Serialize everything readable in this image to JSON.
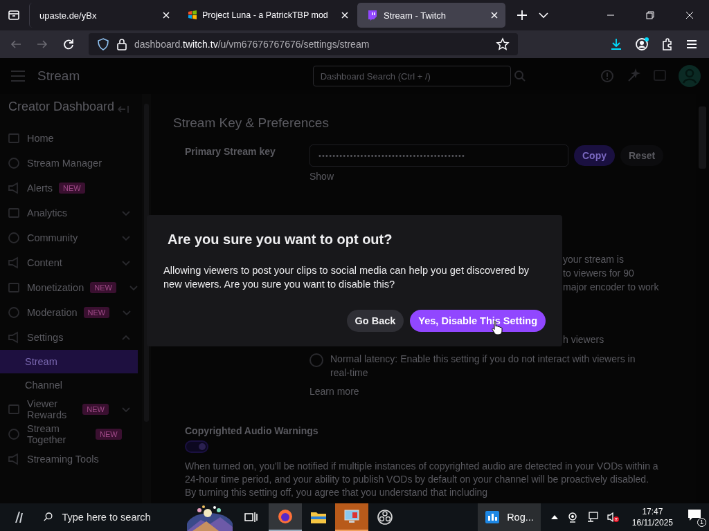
{
  "browser": {
    "tabs": [
      {
        "title": "upaste.de/yBx",
        "selected": false
      },
      {
        "title": "Project Luna - a PatrickTBP mod",
        "selected": false
      },
      {
        "title": "Stream - Twitch",
        "selected": true
      }
    ],
    "url": {
      "prefix": "dashboard.",
      "host": "twitch.tv",
      "path": "/u/vm67676767676/settings/stream"
    }
  },
  "topbar": {
    "title": "Stream",
    "search_placeholder": "Dashboard Search (Ctrl + /)"
  },
  "sidebar": {
    "title": "Creator Dashboard",
    "items": [
      {
        "label": "Home",
        "kind": "link"
      },
      {
        "label": "Stream Manager",
        "kind": "link"
      },
      {
        "label": "Alerts",
        "kind": "link",
        "badge": "NEW"
      },
      {
        "label": "Analytics",
        "kind": "group",
        "expanded": false
      },
      {
        "label": "Community",
        "kind": "group",
        "expanded": false
      },
      {
        "label": "Content",
        "kind": "group",
        "expanded": false
      },
      {
        "label": "Monetization",
        "kind": "group",
        "expanded": false,
        "badge": "NEW"
      },
      {
        "label": "Moderation",
        "kind": "group",
        "expanded": false,
        "badge": "NEW"
      },
      {
        "label": "Settings",
        "kind": "group",
        "expanded": true,
        "children": [
          {
            "label": "Stream",
            "selected": true
          },
          {
            "label": "Channel",
            "selected": false
          }
        ]
      },
      {
        "label": "Viewer Rewards",
        "kind": "group",
        "expanded": false,
        "badge": "NEW"
      },
      {
        "label": "Stream Together",
        "kind": "link",
        "badge": "NEW"
      },
      {
        "label": "Streaming Tools",
        "kind": "link"
      }
    ]
  },
  "main": {
    "title": "Stream Key & Preferences",
    "key_label": "Primary Stream key",
    "key_value": "••••••••••••••••••••••••••••••••••••••••••",
    "copy": "Copy",
    "reset": "Reset",
    "show": "Show",
    "latency_fragments": [
      "your stream is",
      "to viewers for 90",
      "major encoder to work"
    ],
    "latency_fragment_2": "h viewers",
    "normal_latency": {
      "label": "Normal latency: Enable this setting if you do not interact with viewers in real-time",
      "selected": false
    },
    "learn_more": "Learn more",
    "audio_title": "Copyrighted Audio Warnings",
    "audio_toggle": {
      "on": true
    },
    "audio_text": "When turned on, you'll be notified if multiple instances of copyrighted audio are detected in your VODs within a 24-hour time period, and your ability to publish VODs by default on your channel will be proactively disabled. By turning this setting off, you agree that you understand that including"
  },
  "dialog": {
    "title": "Are you sure you want to opt out?",
    "text": "Allowing viewers to post your clips to social media can help you get discovered by new viewers. Are you sure you want to disable this?",
    "cancel": "Go Back",
    "confirm": "Yes, Disable This Setting"
  },
  "taskbar": {
    "search_placeholder": "Type here to search",
    "app_label": "Rog...",
    "time": "17:47",
    "date": "16/11/2025",
    "notifications": "1"
  }
}
